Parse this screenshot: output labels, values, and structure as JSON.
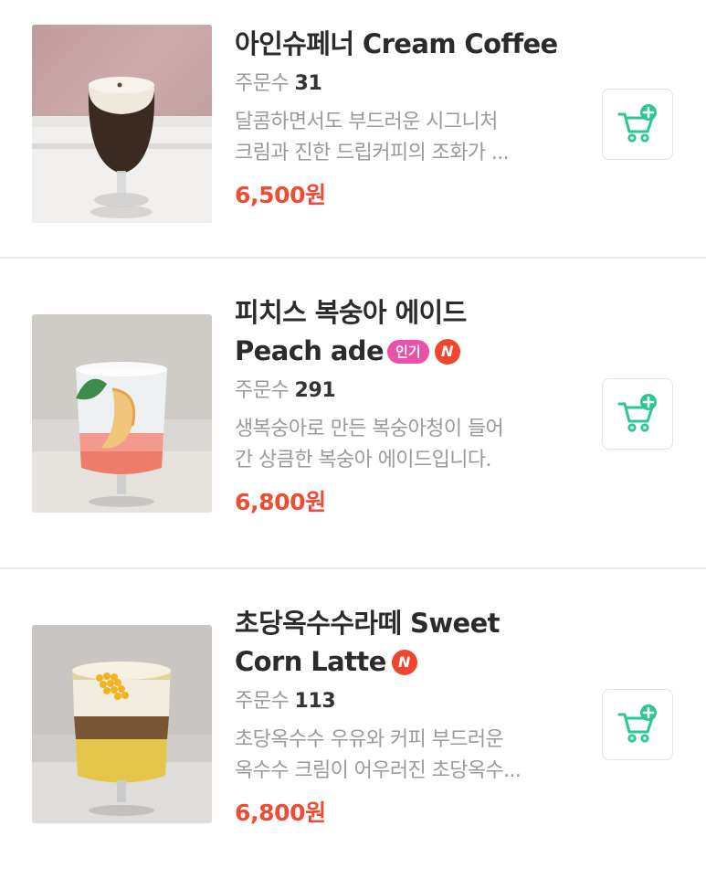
{
  "items": [
    {
      "name_lines": [
        "아인슈페너 Cream Coffee"
      ],
      "orders_label": "주문수",
      "orders_count": "31",
      "desc_lines": [
        "달콤하면서도 부드러운 시그니처",
        "크림과 진한 드립커피의 조화가 ..."
      ],
      "price": "6,500원",
      "badges": []
    },
    {
      "name_lines": [
        "피치스 복숭아 에이드",
        "Peach ade"
      ],
      "orders_label": "주문수",
      "orders_count": "291",
      "desc_lines": [
        "생복숭아로 만든 복숭아청이 들어",
        "간 상큼한 복숭아 에이드입니다."
      ],
      "price": "6,800원",
      "badges": [
        "인기",
        "N"
      ]
    },
    {
      "name_lines": [
        "초당옥수수라떼 Sweet",
        "Corn Latte"
      ],
      "orders_label": "주문수",
      "orders_count": "113",
      "desc_lines": [
        "초당옥수수 우유와 커피 부드러운",
        "옥수수 크림이 어우러진 초당옥수..."
      ],
      "price": "6,800원",
      "badges": [
        "N"
      ]
    }
  ],
  "icons": {
    "cart": "cart-add-icon",
    "thumbnails": [
      "cream-coffee-photo",
      "peach-ade-photo",
      "corn-latte-photo"
    ]
  },
  "colors": {
    "price": "#ef4b35",
    "cart_accent": "#2cc98e",
    "popular_badge": "#ec4fa8",
    "new_badge": "#f0462e"
  }
}
